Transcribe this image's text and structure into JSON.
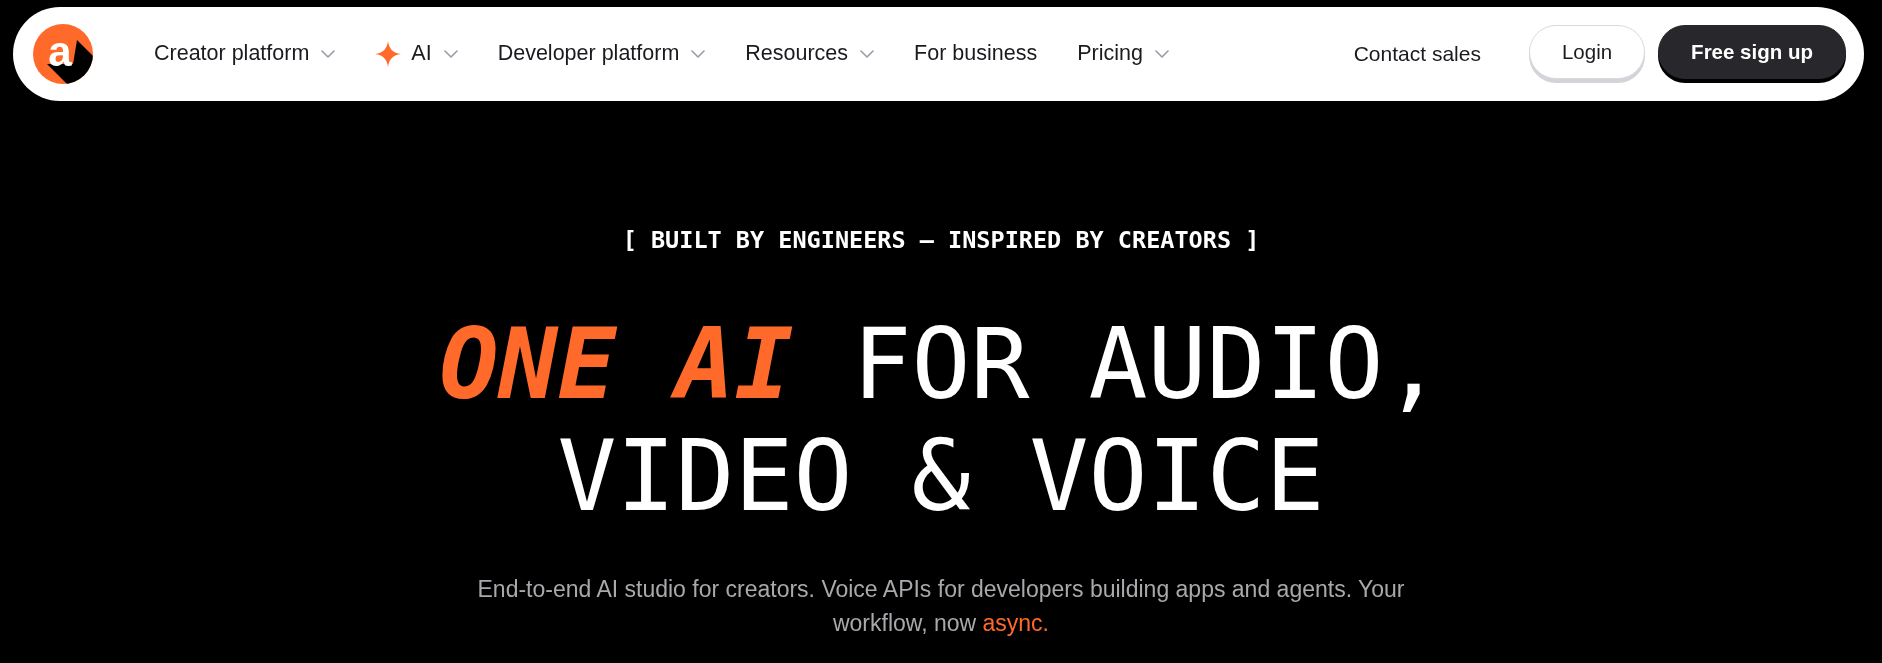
{
  "navbar": {
    "logo": {
      "letter": "a"
    },
    "menu": [
      {
        "label": "Creator platform",
        "kind": "link",
        "dropdown": true
      },
      {
        "label": "AI",
        "kind": "featured",
        "dropdown": true
      },
      {
        "label": "Developer platform",
        "kind": "link",
        "dropdown": true
      },
      {
        "label": "Resources",
        "kind": "link",
        "dropdown": true
      },
      {
        "label": "For business",
        "kind": "link",
        "dropdown": false
      },
      {
        "label": "Pricing",
        "kind": "link",
        "dropdown": true
      }
    ],
    "contact_link": "Contact sales",
    "buttons": [
      {
        "label": "Login",
        "kind": "secondary"
      },
      {
        "label": "Free sign up",
        "kind": "primary"
      }
    ]
  },
  "hero": {
    "eyebrow": "[ BUILT BY ENGINEERS — INSPIRED BY CREATORS ]",
    "headline": {
      "accent": "ONE AI",
      "text": "FOR AUDIO, VIDEO & VOICE"
    },
    "subtitle": {
      "text": "End-to-end AI studio for creators. Voice APIs for developers building apps and agents. Your workflow, now",
      "accent": "async."
    }
  }
}
